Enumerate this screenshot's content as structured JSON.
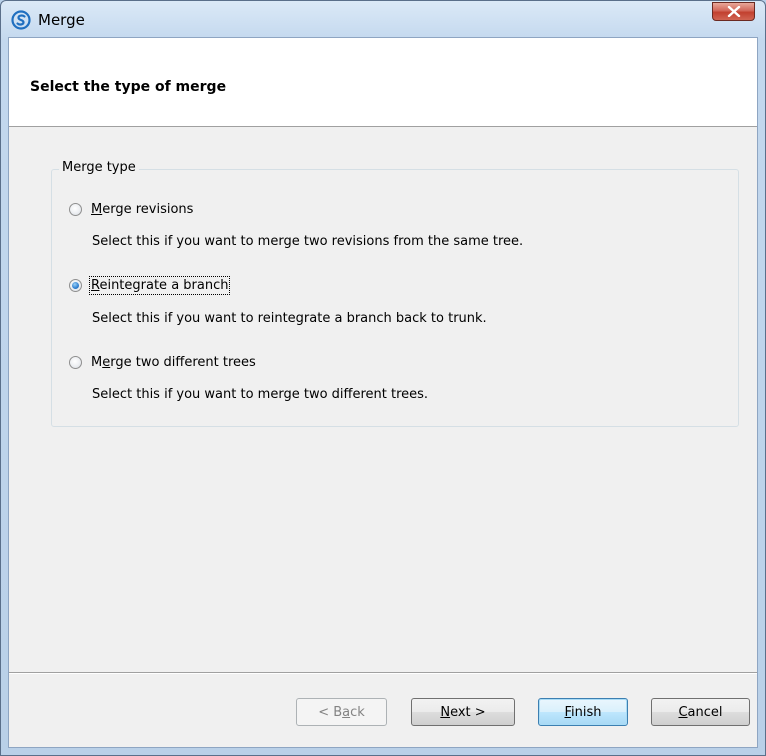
{
  "window": {
    "title": "Merge",
    "close_label": "X"
  },
  "header": {
    "title": "Select the type of merge"
  },
  "group": {
    "label": "Merge type"
  },
  "options": [
    {
      "label": "Merge revisions",
      "mnemonic_index": 0,
      "description": "Select this if you want to merge two revisions from the same tree.",
      "checked": false
    },
    {
      "label": "Reintegrate a branch",
      "mnemonic_index": 0,
      "description": "Select this if you want to reintegrate a branch back to trunk.",
      "checked": true
    },
    {
      "label": "Merge two different trees",
      "mnemonic_index": 1,
      "description": "Select this if you want to merge two different trees.",
      "checked": false
    }
  ],
  "buttons": {
    "back": "< Back",
    "next": "Next >",
    "finish": "Finish",
    "cancel": "Cancel"
  },
  "colors": {
    "accent": "#3c7fb1",
    "close_red": "#c2402f",
    "frame": "#b9d1ea"
  },
  "icons": {
    "app": "smartsvn-logo-icon",
    "close": "close-icon"
  }
}
